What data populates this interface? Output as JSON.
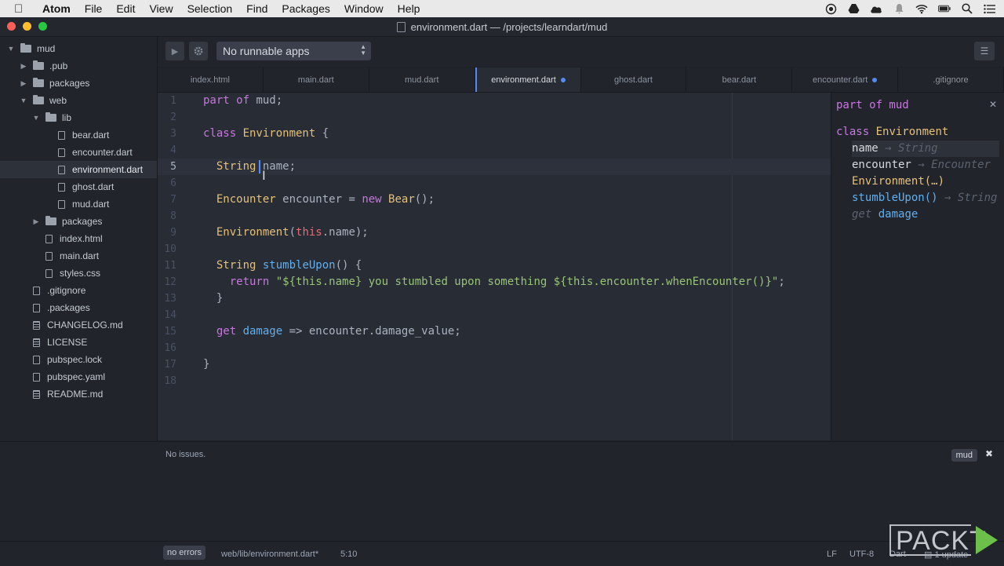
{
  "menubar": {
    "items": [
      "Atom",
      "File",
      "Edit",
      "View",
      "Selection",
      "Find",
      "Packages",
      "Window",
      "Help"
    ],
    "tray_icons": [
      "record-icon",
      "drive-icon",
      "creative-cloud-icon",
      "notification-bell-icon",
      "wifi-icon",
      "battery-icon",
      "spotlight-search-icon",
      "notification-center-icon"
    ]
  },
  "window": {
    "title": "environment.dart — /projects/learndart/mud",
    "colors": {
      "close": "#fd5f57",
      "minimize": "#febc2e",
      "zoom": "#28c840"
    }
  },
  "tree": {
    "rows": [
      {
        "label": "mud",
        "type": "folder",
        "open": true,
        "depth": 0
      },
      {
        "label": ".pub",
        "type": "folder",
        "open": false,
        "depth": 1
      },
      {
        "label": "packages",
        "type": "folder",
        "open": false,
        "depth": 1
      },
      {
        "label": "web",
        "type": "folder",
        "open": true,
        "depth": 1
      },
      {
        "label": "lib",
        "type": "folder",
        "open": true,
        "depth": 2
      },
      {
        "label": "bear.dart",
        "type": "file",
        "depth": 3
      },
      {
        "label": "encounter.dart",
        "type": "file",
        "depth": 3
      },
      {
        "label": "environment.dart",
        "type": "file",
        "depth": 3,
        "selected": true
      },
      {
        "label": "ghost.dart",
        "type": "file",
        "depth": 3
      },
      {
        "label": "mud.dart",
        "type": "file",
        "depth": 3
      },
      {
        "label": "packages",
        "type": "folder",
        "open": false,
        "depth": 2
      },
      {
        "label": "index.html",
        "type": "file",
        "depth": 2
      },
      {
        "label": "main.dart",
        "type": "file",
        "depth": 2
      },
      {
        "label": "styles.css",
        "type": "file",
        "depth": 2
      },
      {
        "label": ".gitignore",
        "type": "file",
        "depth": 1
      },
      {
        "label": ".packages",
        "type": "file",
        "depth": 1
      },
      {
        "label": "CHANGELOG.md",
        "type": "doc",
        "depth": 1
      },
      {
        "label": "LICENSE",
        "type": "doc",
        "depth": 1
      },
      {
        "label": "pubspec.lock",
        "type": "file",
        "depth": 1
      },
      {
        "label": "pubspec.yaml",
        "type": "file",
        "depth": 1
      },
      {
        "label": "README.md",
        "type": "book",
        "depth": 1
      }
    ]
  },
  "toolbar": {
    "run_select": "No runnable apps"
  },
  "tabs": [
    {
      "label": "index.html"
    },
    {
      "label": "main.dart"
    },
    {
      "label": "mud.dart"
    },
    {
      "label": "environment.dart",
      "active": true,
      "modified": true
    },
    {
      "label": "ghost.dart"
    },
    {
      "label": "bear.dart"
    },
    {
      "label": "encounter.dart",
      "modified": true
    },
    {
      "label": ".gitignore"
    }
  ],
  "editor": {
    "current_line": 5,
    "lines": [
      [
        [
          "kw",
          "part of "
        ],
        [
          "pl",
          "mud;"
        ]
      ],
      [],
      [
        [
          "kw",
          "class "
        ],
        [
          "ty",
          "Environment"
        ],
        [
          "pl",
          " {"
        ]
      ],
      [],
      [
        [
          "pl",
          "  "
        ],
        [
          "ty",
          "String "
        ],
        [
          "pl",
          "name;"
        ]
      ],
      [],
      [
        [
          "pl",
          "  "
        ],
        [
          "ty",
          "Encounter "
        ],
        [
          "pl",
          "encounter = "
        ],
        [
          "kw",
          "new "
        ],
        [
          "ty",
          "Bear"
        ],
        [
          "pl",
          "();"
        ]
      ],
      [],
      [
        [
          "pl",
          "  "
        ],
        [
          "ty",
          "Environment"
        ],
        [
          "pl",
          "("
        ],
        [
          "th",
          "this"
        ],
        [
          "pl",
          ".name);"
        ]
      ],
      [],
      [
        [
          "pl",
          "  "
        ],
        [
          "ty",
          "String "
        ],
        [
          "fn",
          "stumbleUpon"
        ],
        [
          "pl",
          "() {"
        ]
      ],
      [
        [
          "pl",
          "    "
        ],
        [
          "kw",
          "return "
        ],
        [
          "st",
          "\"${this.name} you stumbled upon something ${this.encounter.whenEncounter()}\""
        ],
        [
          "pl",
          ";"
        ]
      ],
      [
        [
          "pl",
          "  }"
        ]
      ],
      [],
      [
        [
          "pl",
          "  "
        ],
        [
          "kw",
          "get "
        ],
        [
          "fn",
          "damage "
        ],
        [
          "pl",
          "=> encounter.damage_value;"
        ]
      ],
      [],
      [
        [
          "pl",
          "}"
        ]
      ],
      []
    ]
  },
  "outline": {
    "header": "part of mud",
    "class_kw": "class",
    "class_name": "Environment",
    "members": [
      {
        "name": "name",
        "type": "String",
        "selected": true,
        "style": "field"
      },
      {
        "name": "encounter",
        "type": "Encounter",
        "style": "field"
      },
      {
        "name": "Environment(…)",
        "type": "",
        "style": "ctor"
      },
      {
        "name": "stumbleUpon()",
        "type": "String",
        "style": "method"
      },
      {
        "name": "damage",
        "prefix": "get",
        "type": "",
        "style": "getter"
      }
    ],
    "arrow": "→"
  },
  "issues": {
    "message": "No issues.",
    "project_badge": "mud"
  },
  "status": {
    "errors": "no errors",
    "path": "web/lib/environment.dart*",
    "position": "5:10",
    "line_ending": "LF",
    "encoding": "UTF-8",
    "grammar": "Dart",
    "updates": "1 update"
  },
  "watermark": {
    "text": "PACKT"
  }
}
